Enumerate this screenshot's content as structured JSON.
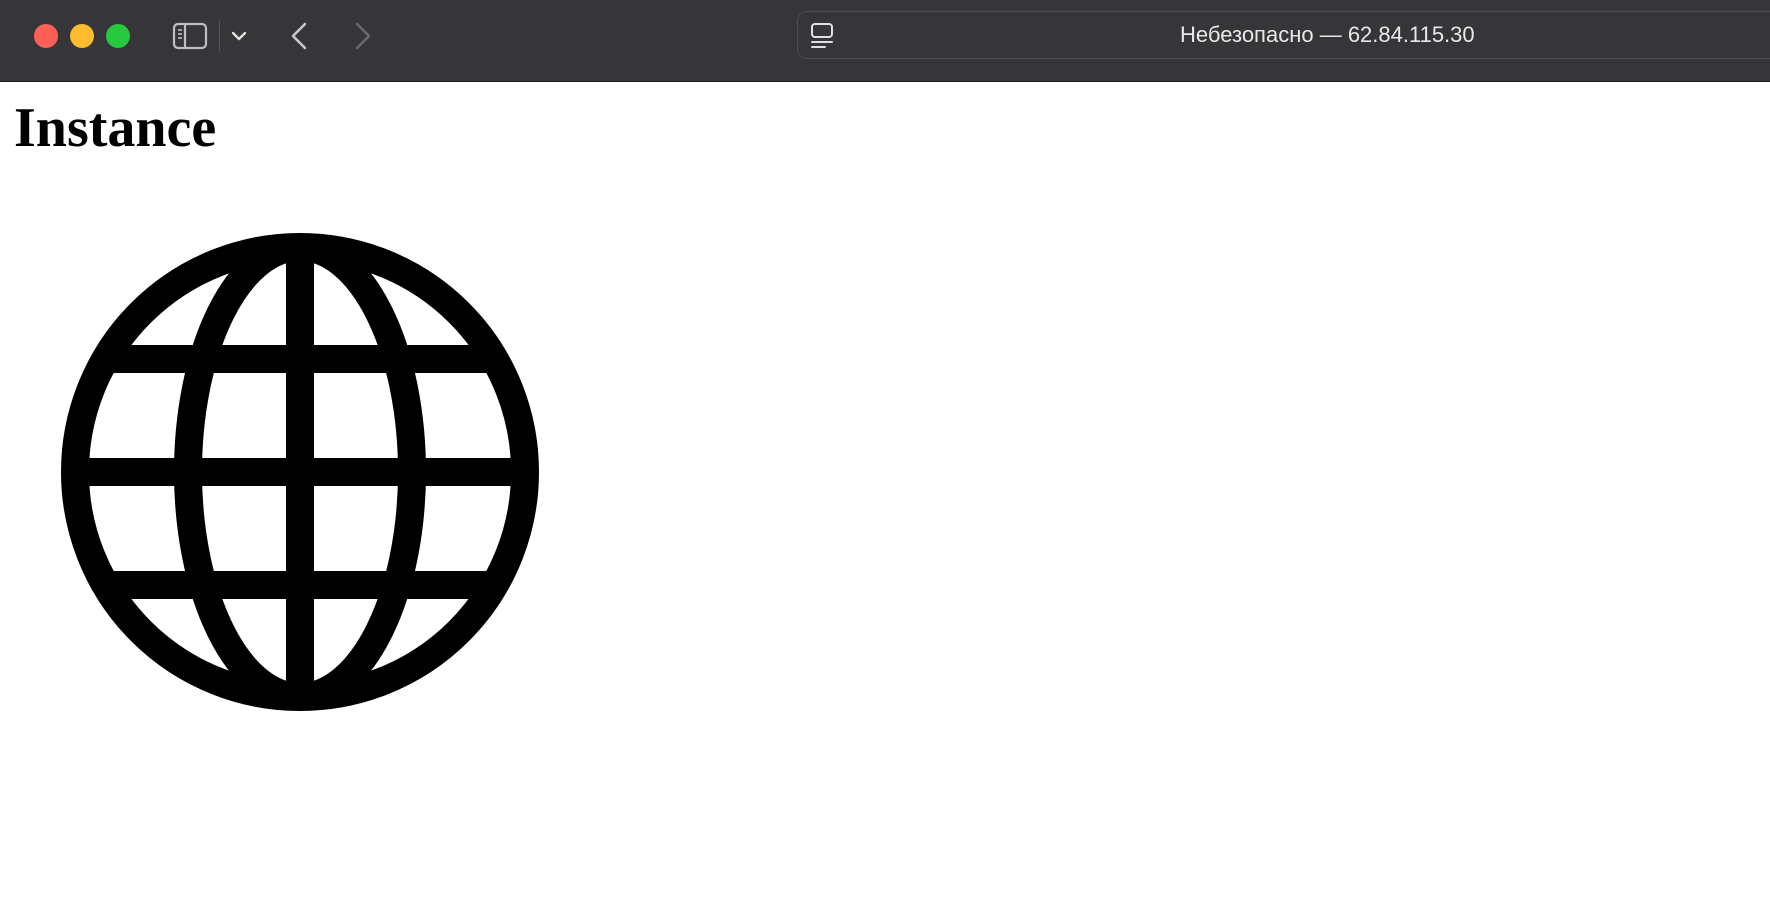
{
  "browser": {
    "address_text": "Небезопасно — 62.84.115.30",
    "colors": {
      "toolbar": "#363638",
      "close": "#ff5f57",
      "minimize": "#febc2e",
      "zoom": "#28c840"
    },
    "icons": {
      "sidebar": "sidebar-icon",
      "sidebar_menu": "chevron-down-icon",
      "back": "chevron-left-icon",
      "forward": "chevron-right-icon",
      "reader": "reader-mode-icon"
    }
  },
  "page": {
    "title": "Instance",
    "image_icon": "globe-icon"
  }
}
